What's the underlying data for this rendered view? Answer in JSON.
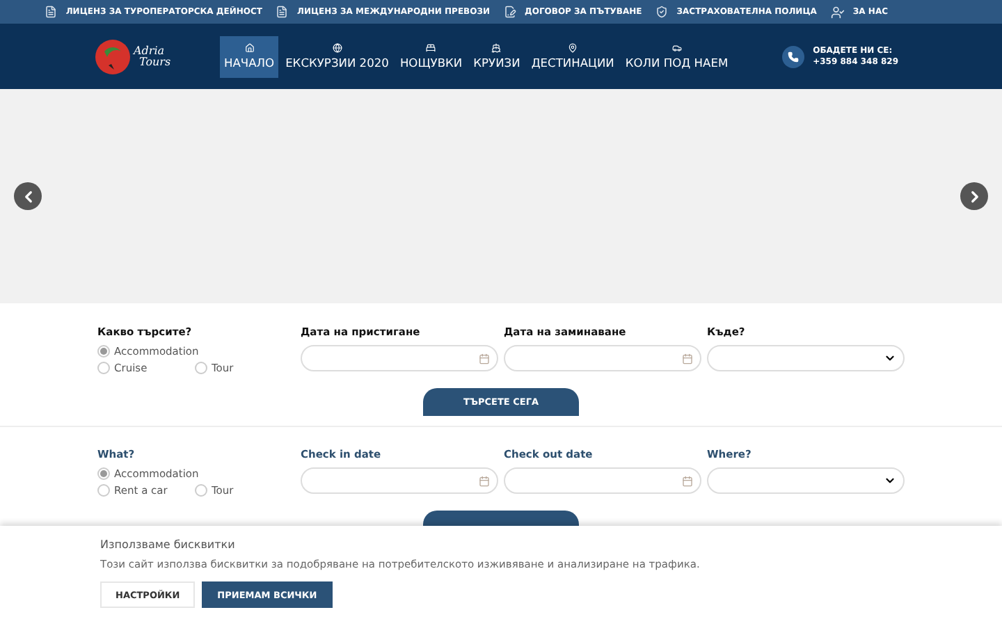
{
  "top_bar": {
    "links": [
      {
        "label": "ЛИЦЕНЗ ЗА ТУРОПЕРАТОРСКА ДЕЙНОСТ",
        "kind": "document"
      },
      {
        "label": "ЛИЦЕНЗ ЗА МЕЖДУНАРОДНИ ПРЕВОЗИ",
        "kind": "document"
      },
      {
        "label": "ДОГОВОР ЗА ПЪТУВАНЕ",
        "kind": "contract"
      },
      {
        "label": "ЗАСТРАХОВАТЕЛНА ПОЛИЦА",
        "kind": "shield"
      },
      {
        "label": "ЗА НАС",
        "kind": "user"
      }
    ]
  },
  "header": {
    "logo": {
      "line_1": "Adria",
      "line_2": "Tours"
    },
    "nav": [
      {
        "label": "НАЧАЛО",
        "selected": true
      },
      {
        "label": "ЕКСКУРЗИИ 2020",
        "selected": false
      },
      {
        "label": "НОЩУВКИ",
        "selected": false
      },
      {
        "label": "КРУИЗИ",
        "selected": false
      },
      {
        "label": "ДЕСТИНАЦИИ",
        "selected": false
      },
      {
        "label": "КОЛИ ПОД НАЕМ",
        "selected": false
      }
    ],
    "contact": {
      "label": "ОБАДЕТЕ НИ СЕ:",
      "phone": "+359 884 348 829"
    }
  },
  "search_forms": [
    {
      "what_label": "Какво търсите?",
      "options": [
        {
          "label": "Accommodation",
          "selected": true
        },
        {
          "label": "Cruise",
          "selected": false
        },
        {
          "label": "Tour",
          "selected": false
        }
      ],
      "checkin_label": "Дата на пристигане",
      "checkout_label": "Дата на заминаване",
      "where_label": "Къде?",
      "button": "ТЪРСЕТЕ СЕГА"
    },
    {
      "what_label": "What?",
      "options": [
        {
          "label": "Accommodation",
          "selected": true
        },
        {
          "label": "Rent a car",
          "selected": false
        },
        {
          "label": "Tour",
          "selected": false
        }
      ],
      "checkin_label": "Check in date",
      "checkout_label": "Check out date",
      "where_label": "Where?"
    }
  ],
  "cookie_banner": {
    "title": "Използваме бисквитки",
    "text": "Този сайт използва бисквитки за подобряване на потребителското изживяване и анализиране на трафика.",
    "buttons": [
      {
        "label": "НАСТРОЙКИ",
        "kind": "secondary"
      },
      {
        "label": "ПРИЕМАМ ВСИЧКИ",
        "kind": "primary"
      }
    ]
  }
}
